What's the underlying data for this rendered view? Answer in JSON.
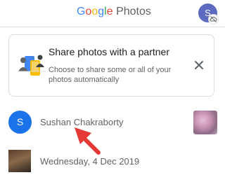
{
  "header": {
    "logo_letters": [
      {
        "char": "G",
        "color": "#4285F4"
      },
      {
        "char": "o",
        "color": "#EA4335"
      },
      {
        "char": "o",
        "color": "#FBBC05"
      },
      {
        "char": "g",
        "color": "#4285F4"
      },
      {
        "char": "l",
        "color": "#34A853"
      },
      {
        "char": "e",
        "color": "#EA4335"
      }
    ],
    "logo_suffix": " Photos",
    "avatar_initial": "S",
    "avatar_badge_icon": "cloud-off-icon"
  },
  "share_card": {
    "illustration_icon": "partner-sharing-illustration",
    "title": "Share photos with a partner",
    "description": "Choose to share some or all of your photos automatically",
    "close_icon": "close-icon"
  },
  "sharing_row": {
    "avatar_initial": "S",
    "name": "Sushan Chakraborty"
  },
  "date_row": {
    "date": "Wednesday, 4 Dec 2019"
  },
  "colors": {
    "partner_avatar": "#1a73e8",
    "top_avatar": "#5c6bc0",
    "arrow": "#e53935"
  }
}
